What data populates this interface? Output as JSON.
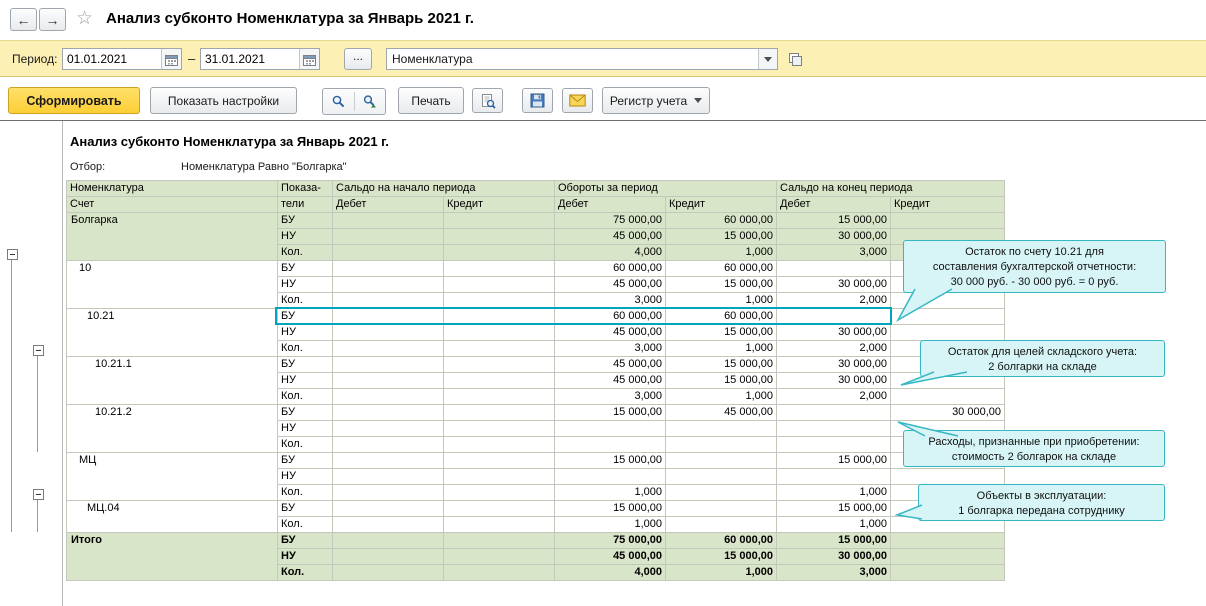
{
  "window": {
    "back": "←",
    "forward": "→",
    "star": "☆",
    "title": "Анализ субконто Номенклатура за Январь 2021 г."
  },
  "period_bar": {
    "label": "Период:",
    "date_from": "01.01.2021",
    "dash": "–",
    "date_to": "31.01.2021",
    "more": "...",
    "subconto": "Номенклатура"
  },
  "toolbar": {
    "generate": "Сформировать",
    "settings": "Показать настройки",
    "print": "Печать",
    "register": "Регистр учета"
  },
  "report": {
    "title": "Анализ субконто Номенклатура за Январь 2021 г.",
    "filter_label": "Отбор:",
    "filter_value": "Номенклатура Равно \"Болгарка\"",
    "header": {
      "col_nomenclature": "Номенклатура",
      "col_account": "Счет",
      "col_indicator_1": "Показа-",
      "col_indicator_2": "тели",
      "saldo_start": "Сальдо на начало периода",
      "turnover": "Обороты за период",
      "saldo_end": "Сальдо на конец периода",
      "debit": "Дебет",
      "credit": "Кредит"
    },
    "groups": [
      {
        "name": "Болгарка",
        "indent": 0,
        "style": "group",
        "rows": [
          {
            "ind": "БУ",
            "cells": [
              "",
              "",
              "75 000,00",
              "60 000,00",
              "15 000,00",
              ""
            ]
          },
          {
            "ind": "НУ",
            "cells": [
              "",
              "",
              "45 000,00",
              "15 000,00",
              "30 000,00",
              ""
            ]
          },
          {
            "ind": "Кол.",
            "cells": [
              "",
              "",
              "4,000",
              "1,000",
              "3,000",
              ""
            ]
          }
        ]
      },
      {
        "name": "10",
        "indent": 1,
        "style": "",
        "rows": [
          {
            "ind": "БУ",
            "cells": [
              "",
              "",
              "60 000,00",
              "60 000,00",
              "",
              ""
            ]
          },
          {
            "ind": "НУ",
            "cells": [
              "",
              "",
              "45 000,00",
              "15 000,00",
              "30 000,00",
              ""
            ]
          },
          {
            "ind": "Кол.",
            "cells": [
              "",
              "",
              "3,000",
              "1,000",
              "2,000",
              ""
            ]
          }
        ]
      },
      {
        "name": "10.21",
        "indent": 2,
        "style": "",
        "rows": [
          {
            "ind": "БУ",
            "cells": [
              "",
              "",
              "60 000,00",
              "60 000,00",
              "",
              ""
            ],
            "highlight": true
          },
          {
            "ind": "НУ",
            "cells": [
              "",
              "",
              "45 000,00",
              "15 000,00",
              "30 000,00",
              ""
            ]
          },
          {
            "ind": "Кол.",
            "cells": [
              "",
              "",
              "3,000",
              "1,000",
              "2,000",
              ""
            ]
          }
        ]
      },
      {
        "name": "10.21.1",
        "indent": 3,
        "style": "",
        "rows": [
          {
            "ind": "БУ",
            "cells": [
              "",
              "",
              "45 000,00",
              "15 000,00",
              "30 000,00",
              ""
            ]
          },
          {
            "ind": "НУ",
            "cells": [
              "",
              "",
              "45 000,00",
              "15 000,00",
              "30 000,00",
              ""
            ]
          },
          {
            "ind": "Кол.",
            "cells": [
              "",
              "",
              "3,000",
              "1,000",
              "2,000",
              ""
            ]
          }
        ]
      },
      {
        "name": "10.21.2",
        "indent": 3,
        "style": "",
        "rows": [
          {
            "ind": "БУ",
            "cells": [
              "",
              "",
              "15 000,00",
              "45 000,00",
              "",
              "30 000,00"
            ]
          },
          {
            "ind": "НУ",
            "cells": [
              "",
              "",
              "",
              "",
              "",
              ""
            ]
          },
          {
            "ind": "Кол.",
            "cells": [
              "",
              "",
              "",
              "",
              "",
              ""
            ]
          }
        ]
      },
      {
        "name": "МЦ",
        "indent": 1,
        "style": "",
        "rows": [
          {
            "ind": "БУ",
            "cells": [
              "",
              "",
              "15 000,00",
              "",
              "15 000,00",
              ""
            ]
          },
          {
            "ind": "НУ",
            "cells": [
              "",
              "",
              "",
              "",
              "",
              ""
            ]
          },
          {
            "ind": "Кол.",
            "cells": [
              "",
              "",
              "1,000",
              "",
              "1,000",
              ""
            ]
          }
        ]
      },
      {
        "name": "МЦ.04",
        "indent": 2,
        "style": "",
        "rows": [
          {
            "ind": "БУ",
            "cells": [
              "",
              "",
              "15 000,00",
              "",
              "15 000,00",
              ""
            ]
          },
          {
            "ind": "Кол.",
            "cells": [
              "",
              "",
              "1,000",
              "",
              "1,000",
              ""
            ]
          }
        ]
      },
      {
        "name": "Итого",
        "indent": 0,
        "style": "total",
        "rows": [
          {
            "ind": "БУ",
            "cells": [
              "",
              "",
              "75 000,00",
              "60 000,00",
              "15 000,00",
              ""
            ]
          },
          {
            "ind": "НУ",
            "cells": [
              "",
              "",
              "45 000,00",
              "15 000,00",
              "30 000,00",
              ""
            ]
          },
          {
            "ind": "Кол.",
            "cells": [
              "",
              "",
              "4,000",
              "1,000",
              "3,000",
              ""
            ]
          }
        ]
      }
    ]
  },
  "callouts": [
    {
      "text": "Остаток по счету 10.21 для\nсоставления бухгалтерской отчетности:\n30 000 руб. - 30 000 руб. = 0 руб."
    },
    {
      "text": "Остаток для целей складского учета:\n2 болгарки на складе"
    },
    {
      "text": "Расходы, признанные при приобретении:\nстоимость 2 болгарок на складе"
    },
    {
      "text": "Объекты в эксплуатации:\n1 болгарка передана сотруднику"
    }
  ],
  "colors": {
    "bar_yellow": "#fdf0b5",
    "generate_yellow": "#fccf35",
    "group_green": "#d9e5c9",
    "highlight_teal": "#00a5bd",
    "callout_fill": "#d7f5f7",
    "callout_border": "#36b7c4"
  }
}
